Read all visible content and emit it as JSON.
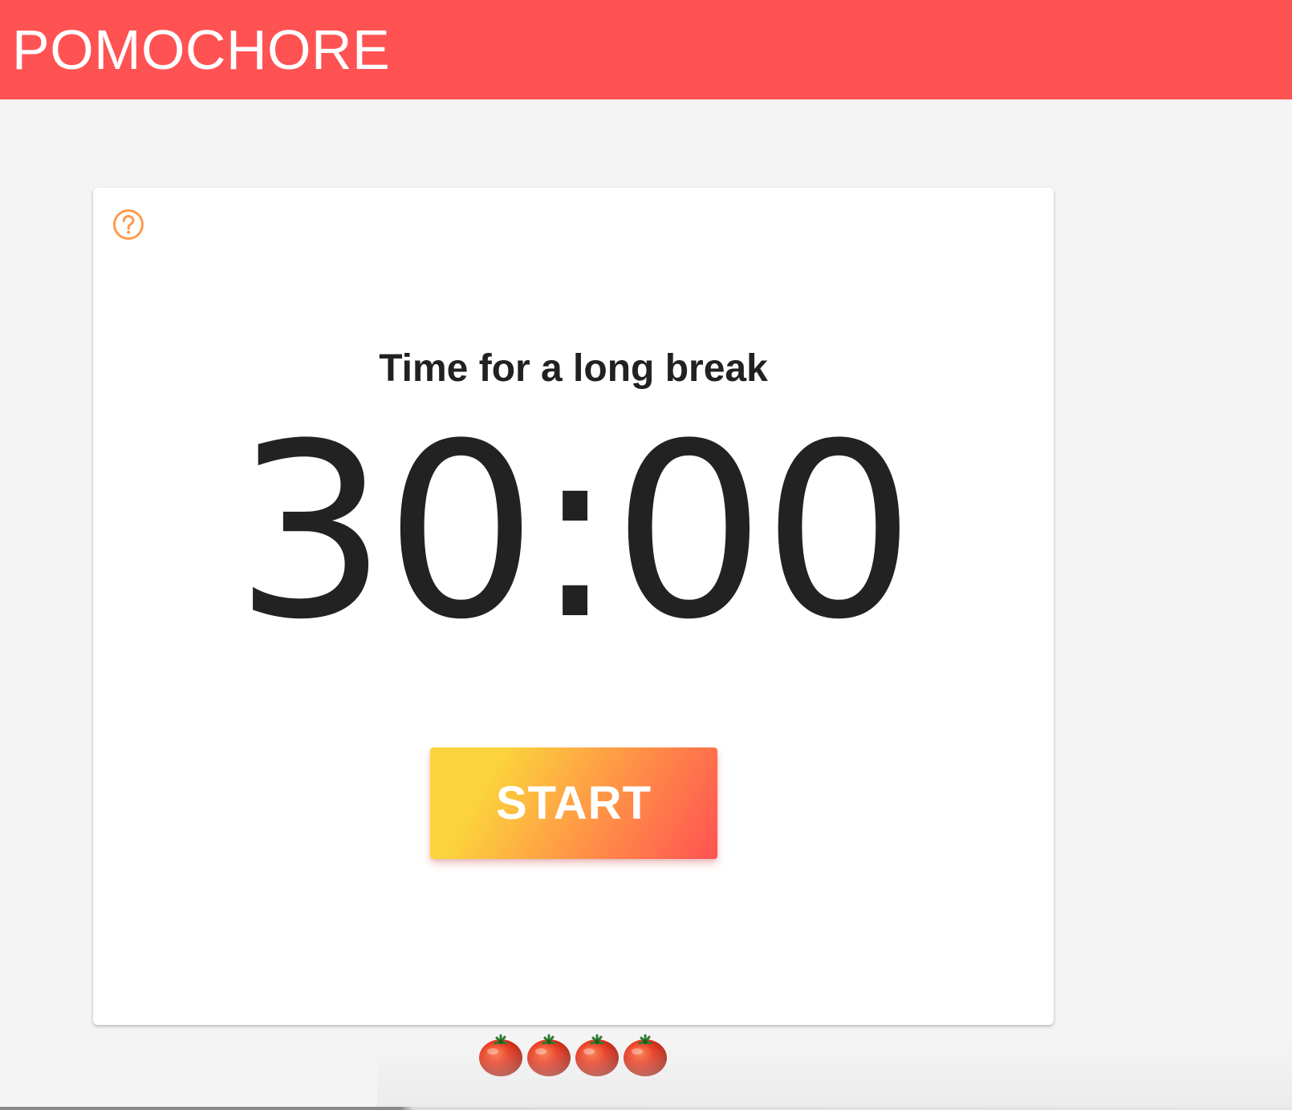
{
  "app": {
    "title": "POMOCHORE"
  },
  "timer_card": {
    "help_icon": "help-circle-icon",
    "status_text": "Time for a long break",
    "time_display": "30:00",
    "start_label": "START"
  },
  "progress": {
    "completed_pomodoros": 4,
    "icon": "tomato-icon"
  },
  "colors": {
    "app_bar": "#ff5252",
    "page_background": "#f4f4f4",
    "card_background": "#ffffff",
    "help_icon": "#ff9a4d",
    "button_gradient_start": "#fbd33c",
    "button_gradient_end": "#ff5252",
    "timer_text": "#222222"
  }
}
